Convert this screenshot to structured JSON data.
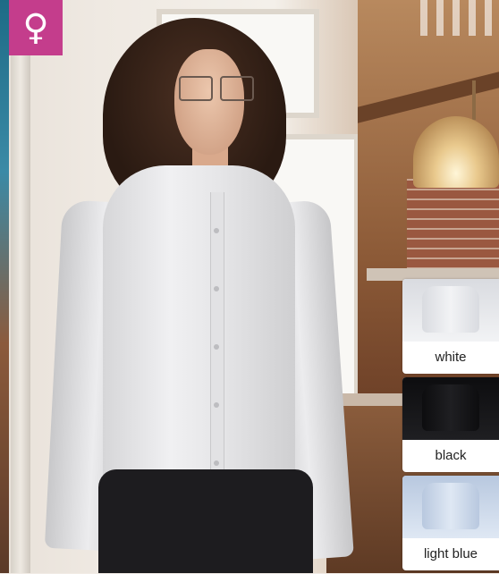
{
  "badge": {
    "icon": "female-symbol-icon",
    "glyph": "♀",
    "color": "#c43d8c"
  },
  "swatches": [
    {
      "label": "white",
      "color": "#f2f3f5",
      "shade": "#d9dbe0"
    },
    {
      "label": "black",
      "color": "#1f1f22",
      "shade": "#0d0d0f"
    },
    {
      "label": "light blue",
      "color": "#dfe8f4",
      "shade": "#b8c8df"
    }
  ]
}
